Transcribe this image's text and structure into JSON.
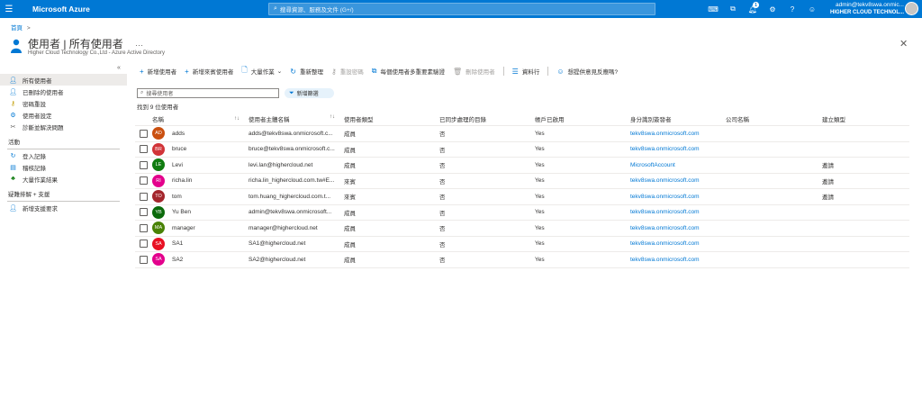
{
  "topbar": {
    "brand": "Microsoft Azure",
    "search_placeholder": "搜尋資源、服務及文件 (G+/)",
    "notification_count": "1",
    "account_email": "admin@tekv8swa.onmic...",
    "account_tenant": "HIGHER CLOUD TECHNOL..."
  },
  "breadcrumb": {
    "home": "首頁",
    "sep": ">"
  },
  "header": {
    "title": "使用者 | 所有使用者",
    "more": "···",
    "subtitle": "Higher Cloud Technology Co.,Ltd - Azure Active Directory"
  },
  "sidebar": {
    "collapse": "«",
    "items": [
      {
        "label": "所有使用者",
        "icon": "user-icon"
      },
      {
        "label": "已刪除的使用者",
        "icon": "user-icon"
      },
      {
        "label": "密碼重設",
        "icon": "key-icon"
      },
      {
        "label": "使用者設定",
        "icon": "settings-icon"
      },
      {
        "label": "診斷並解決問題",
        "icon": "wrench-icon"
      }
    ],
    "section_activity": "活動",
    "activity_items": [
      {
        "label": "登入記錄"
      },
      {
        "label": "稽核記錄"
      },
      {
        "label": "大量作業結果"
      }
    ],
    "section_support": "疑難排解 + 支援",
    "support_items": [
      {
        "label": "新增支援要求"
      }
    ]
  },
  "toolbar": {
    "new_user": "新增使用者",
    "new_guest": "新增來賓使用者",
    "bulk": "大量作業",
    "refresh": "重新整理",
    "reset_password": "重設密碼",
    "mfa": "每個使用者多重要素驗證",
    "delete": "刪除使用者",
    "columns": "資料行",
    "feedback": "想提供意見反應嗎?"
  },
  "filter": {
    "placeholder": "搜尋使用者",
    "add_filter": "新增篩選",
    "count_text": "找到 9 位使用者"
  },
  "table": {
    "headers": {
      "name": "名稱",
      "upn": "使用者主體名稱",
      "type": "使用者類型",
      "sync": "已同步處理的目錄",
      "enabled": "帳戶已啟用",
      "issuer": "身分識別簽發者",
      "company": "公司名稱",
      "creation": "建立類型"
    },
    "sort_glyph": "↑↓",
    "rows": [
      {
        "initials": "AD",
        "color": "#ca5010",
        "name": "adds",
        "upn": "adds@tekv8swa.onmicrosoft.c...",
        "type": "成員",
        "sync": "否",
        "enabled": "Yes",
        "issuer": "tekv8swa.onmicrosoft.com",
        "company": "",
        "creation": ""
      },
      {
        "initials": "BR",
        "color": "#d13438",
        "name": "bruce",
        "upn": "bruce@tekv8swa.onmicrosoft.c...",
        "type": "成員",
        "sync": "否",
        "enabled": "Yes",
        "issuer": "tekv8swa.onmicrosoft.com",
        "company": "",
        "creation": ""
      },
      {
        "initials": "LE",
        "color": "#107c10",
        "name": "Levi",
        "upn": "levi.lan@highercloud.net",
        "type": "成員",
        "sync": "否",
        "enabled": "Yes",
        "issuer": "MicrosoftAccount",
        "company": "",
        "creation": "邀請"
      },
      {
        "initials": "RI",
        "color": "#e3008c",
        "name": "richa.lin",
        "upn": "richa.lin_highercloud.com.tw#E...",
        "type": "來賓",
        "sync": "否",
        "enabled": "Yes",
        "issuer": "tekv8swa.onmicrosoft.com",
        "company": "",
        "creation": "邀請"
      },
      {
        "initials": "TO",
        "color": "#a4262c",
        "name": "tom",
        "upn": "tom.huang_highercloud.com.t...",
        "type": "來賓",
        "sync": "否",
        "enabled": "Yes",
        "issuer": "tekv8swa.onmicrosoft.com",
        "company": "",
        "creation": "邀請"
      },
      {
        "initials": "YB",
        "color": "#0b6a0b",
        "name": "Yu Ben",
        "upn": "admin@tekv8swa.onmicrosoft...",
        "type": "成員",
        "sync": "否",
        "enabled": "Yes",
        "issuer": "tekv8swa.onmicrosoft.com",
        "company": "",
        "creation": ""
      },
      {
        "initials": "MA",
        "color": "#498205",
        "name": "manager",
        "upn": "manager@highercloud.net",
        "type": "成員",
        "sync": "否",
        "enabled": "Yes",
        "issuer": "tekv8swa.onmicrosoft.com",
        "company": "",
        "creation": ""
      },
      {
        "initials": "SA",
        "color": "#e81123",
        "name": "SA1",
        "upn": "SA1@highercloud.net",
        "type": "成員",
        "sync": "否",
        "enabled": "Yes",
        "issuer": "tekv8swa.onmicrosoft.com",
        "company": "",
        "creation": ""
      },
      {
        "initials": "SA",
        "color": "#e3008c",
        "name": "SA2",
        "upn": "SA2@highercloud.net",
        "type": "成員",
        "sync": "否",
        "enabled": "Yes",
        "issuer": "tekv8swa.onmicrosoft.com",
        "company": "",
        "creation": ""
      }
    ]
  }
}
